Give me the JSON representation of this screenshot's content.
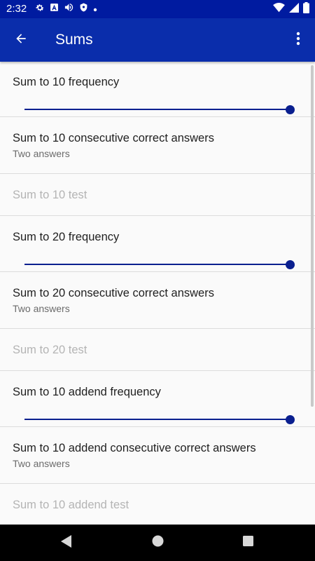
{
  "status_bar": {
    "time": "2:32",
    "icons_left": [
      "settings-icon",
      "a-letter-icon",
      "volume-icon",
      "shield-icon",
      "dot-icon"
    ],
    "icons_right": [
      "wifi-icon",
      "signal-icon",
      "battery-icon"
    ]
  },
  "app_bar": {
    "title": "Sums",
    "back_icon": "arrow-back-icon",
    "menu_icon": "more-vert-icon"
  },
  "preferences": [
    {
      "type": "slider",
      "title": "Sum to 10 frequency",
      "value_fraction": 1.0
    },
    {
      "type": "summary",
      "title": "Sum to 10 consecutive correct answers",
      "summary": "Two answers"
    },
    {
      "type": "disabled",
      "title": "Sum to 10 test"
    },
    {
      "type": "slider",
      "title": "Sum to 20 frequency",
      "value_fraction": 1.0
    },
    {
      "type": "summary",
      "title": "Sum to 20 consecutive correct answers",
      "summary": "Two answers"
    },
    {
      "type": "disabled",
      "title": "Sum to 20 test"
    },
    {
      "type": "slider",
      "title": "Sum to 10 addend frequency",
      "value_fraction": 1.0
    },
    {
      "type": "summary",
      "title": "Sum to 10 addend consecutive correct answers",
      "summary": "Two answers"
    },
    {
      "type": "disabled",
      "title": "Sum to 10 addend test"
    }
  ],
  "nav_bar": {
    "icons": [
      "nav-back-icon",
      "nav-home-icon",
      "nav-recents-icon"
    ]
  },
  "colors": {
    "status_bar": "#001ba0",
    "app_bar": "#0a2dab",
    "accent": "#0a1f8f",
    "background": "#fafafa",
    "disabled_text": "#b4b4b4"
  }
}
